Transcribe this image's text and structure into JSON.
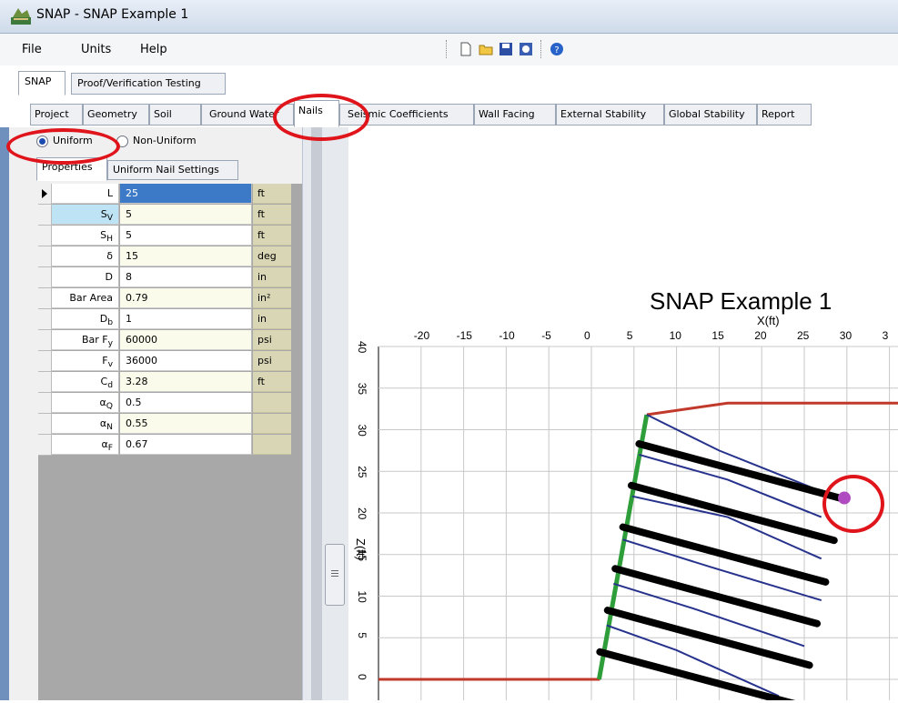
{
  "window": {
    "title": "SNAP - SNAP Example 1"
  },
  "menu": {
    "file": "File",
    "units": "Units",
    "help": "Help"
  },
  "toolbar_icons": [
    "new-file-icon",
    "open-folder-icon",
    "save-icon",
    "print-preview-icon",
    "help-icon"
  ],
  "tabs": {
    "snap": "SNAP",
    "proof": "Proof/Verification Testing"
  },
  "subtabs": [
    "Project",
    "Geometry",
    "Soil",
    "Ground Water",
    "Nails",
    "Seismic Coefficients",
    "Wall Facing",
    "External Stability",
    "Global Stability",
    "Report"
  ],
  "active_subtab": "Nails",
  "nail_mode": {
    "uniform": "Uniform",
    "nonuniform": "Non-Uniform",
    "selected": "Uniform"
  },
  "panel_tabs": {
    "properties": "Properties",
    "uniform_settings": "Uniform Nail Settings"
  },
  "properties": [
    {
      "name": "L",
      "sub": "",
      "value": "25",
      "unit": "ft"
    },
    {
      "name": "S",
      "sub": "V",
      "value": "5",
      "unit": "ft"
    },
    {
      "name": "S",
      "sub": "H",
      "value": "5",
      "unit": "ft"
    },
    {
      "name": "δ",
      "sub": "",
      "value": "15",
      "unit": "deg"
    },
    {
      "name": "D",
      "sub": "",
      "value": "8",
      "unit": "in"
    },
    {
      "name": "Bar Area",
      "sub": "",
      "value": "0.79",
      "unit": "in²"
    },
    {
      "name": "D",
      "sub": "b",
      "value": "1",
      "unit": "in"
    },
    {
      "name": "Bar F",
      "sub": "y",
      "value": "60000",
      "unit": "psi"
    },
    {
      "name": "F",
      "sub": "v",
      "value": "36000",
      "unit": "psi"
    },
    {
      "name": "C",
      "sub": "d",
      "value": "3.28",
      "unit": "ft"
    },
    {
      "name": "α",
      "sub": "Q",
      "value": "0.5",
      "unit": ""
    },
    {
      "name": "α",
      "sub": "N",
      "value": "0.55",
      "unit": ""
    },
    {
      "name": "α",
      "sub": "F",
      "value": "0.67",
      "unit": ""
    }
  ],
  "chart": {
    "title": "SNAP Example 1",
    "xlabel": "X(ft)",
    "ylabel": "Z(ft)",
    "x_ticks": [
      "-20",
      "-15",
      "-10",
      "-5",
      "0",
      "5",
      "10",
      "15",
      "20",
      "25",
      "30",
      "3"
    ],
    "z_ticks": [
      "40",
      "35",
      "30",
      "25",
      "20",
      "15",
      "10",
      "5",
      "0"
    ]
  },
  "colors": {
    "ground": "#c0392b",
    "nail": "#000000",
    "wall": "#2e9e3a",
    "slip": "#26328c",
    "highlight": "#e0141b",
    "marker": "#b04ac0"
  }
}
